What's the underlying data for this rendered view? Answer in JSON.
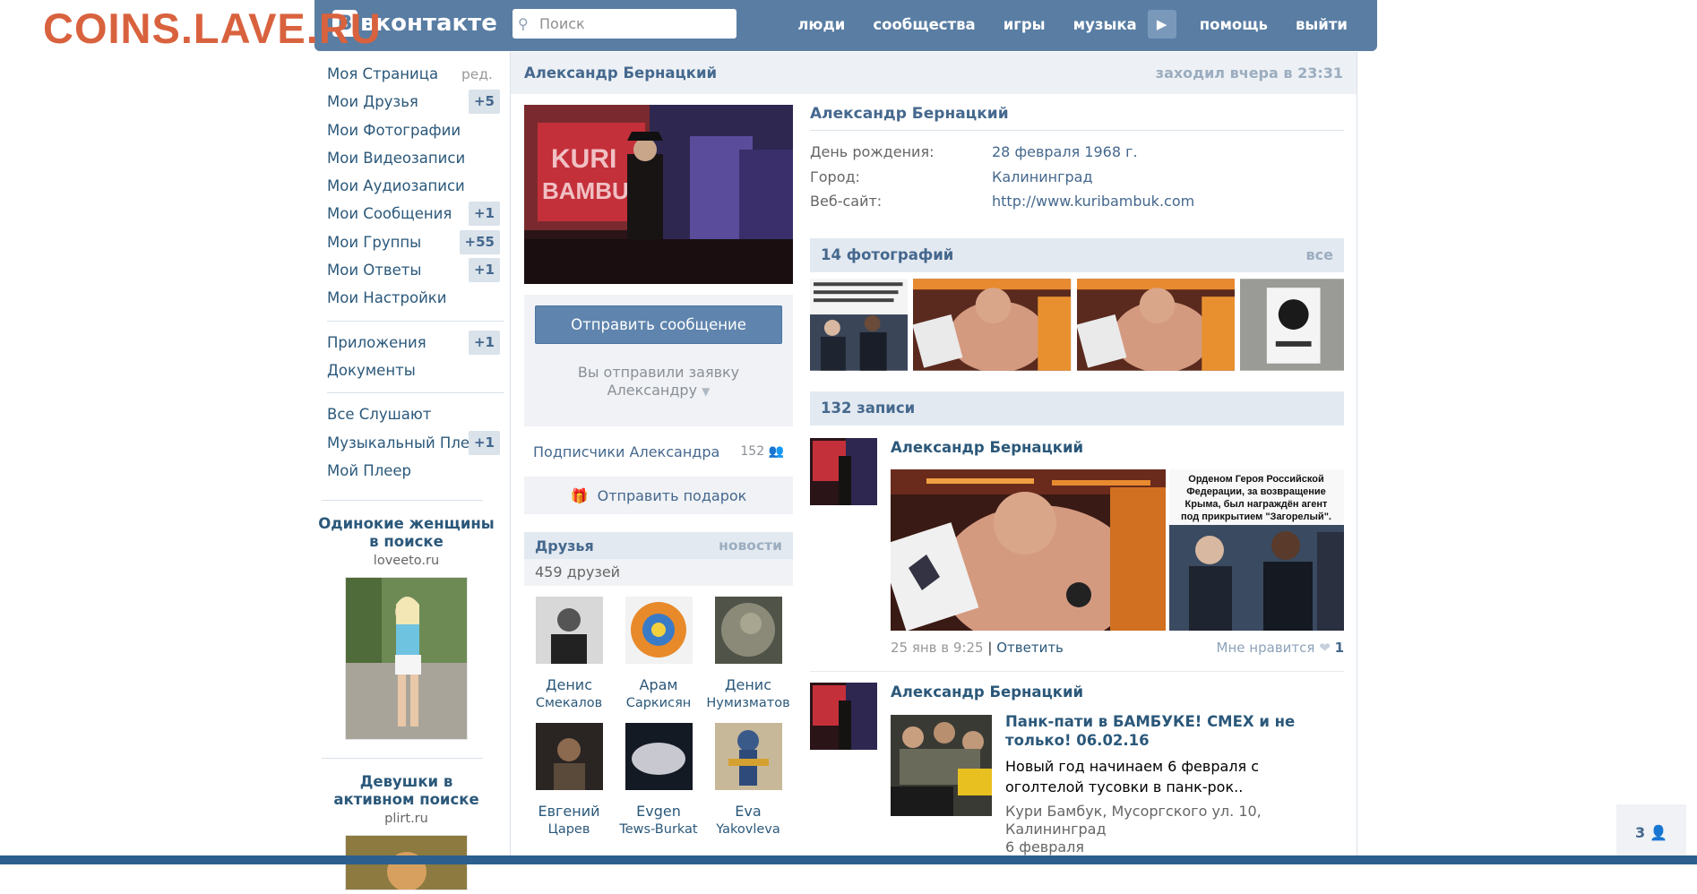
{
  "watermark": "COINS.LAVE.RU",
  "header": {
    "logo": "вконтакте",
    "search_placeholder": "Поиск",
    "nav": [
      "люди",
      "сообщества",
      "игры",
      "музыка",
      "помощь",
      "выйти"
    ]
  },
  "sidebar": {
    "edit": "ред.",
    "items": [
      {
        "label": "Моя Страница",
        "count": ""
      },
      {
        "label": "Мои Друзья",
        "count": "+5"
      },
      {
        "label": "Мои Фотографии",
        "count": ""
      },
      {
        "label": "Мои Видеозаписи",
        "count": ""
      },
      {
        "label": "Мои Аудиозаписи",
        "count": ""
      },
      {
        "label": "Мои Сообщения",
        "count": "+1"
      },
      {
        "label": "Мои Группы",
        "count": "+55"
      },
      {
        "label": "Мои Ответы",
        "count": "+1"
      },
      {
        "label": "Мои Настройки",
        "count": ""
      }
    ],
    "items2": [
      {
        "label": "Приложения",
        "count": "+1"
      },
      {
        "label": "Документы",
        "count": ""
      }
    ],
    "items3": [
      {
        "label": "Все Слушают",
        "count": ""
      },
      {
        "label": "Музыкальный Плеер",
        "count": "+1"
      },
      {
        "label": "Мой Плеер",
        "count": ""
      }
    ],
    "ads": [
      {
        "title": "Одинокие женщины в поиске",
        "url": "loveeto.ru"
      },
      {
        "title": "Девушки в активном поиске",
        "url": "plirt.ru"
      }
    ]
  },
  "profile": {
    "header_name": "Александр Бернацкий",
    "last_seen": "заходил вчера в 23:31",
    "name": "Александр Бернацкий",
    "info": [
      {
        "label": "День рождения:",
        "value": "28 февраля 1968 г."
      },
      {
        "label": "Город:",
        "value": "Калининград"
      },
      {
        "label": "Веб-сайт:",
        "value": "http://www.kuribambuk.com"
      }
    ],
    "send_message": "Отправить сообщение",
    "request_line1": "Вы отправили заявку",
    "request_line2": "Александру",
    "subscribers_label": "Подписчики Александра",
    "subscribers_count": "152",
    "gift": "Отправить подарок"
  },
  "friends": {
    "title": "Друзья",
    "news": "новости",
    "count": "459 друзей",
    "list": [
      {
        "first": "Денис",
        "last": "Смекалов"
      },
      {
        "first": "Арам",
        "last": "Саркисян"
      },
      {
        "first": "Денис",
        "last": "Нумизматов"
      },
      {
        "first": "Евгений",
        "last": "Царев"
      },
      {
        "first": "Evgen",
        "last": "Tews-Burkat"
      },
      {
        "first": "Eva",
        "last": "Yakovleva"
      }
    ]
  },
  "photos": {
    "title": "14 фотографий",
    "all": "все"
  },
  "wall": {
    "title": "132 записи",
    "post1": {
      "author": "Александр Бернацкий",
      "caption": "Орденом Героя Российской Федерации, за возвращение Крыма, был награждён агент под прикрытием \"Загорелый\".",
      "date": "25 янв в 9:25",
      "sep": "|",
      "reply": "Ответить",
      "like_label": "Мне нравится",
      "like_count": "1"
    },
    "post2": {
      "author": "Александр Бернацкий",
      "title": "Панк-пати в БАМБУКЕ! СМЕХ и не только! 06.02.16",
      "desc": "Новый год начинаем 6 февраля с оголтелой тусовки в панк-рок..",
      "meta": "Кури Бамбук, Мусоргского ул. 10, Калининград",
      "date": "6 февраля"
    }
  },
  "corner": {
    "count": "3"
  },
  "icons": {
    "search": "search-icon",
    "play": "play-icon",
    "people": "people-icon",
    "gift": "gift-icon",
    "heart": "heart-icon",
    "dropdown": "chevron-down-icon",
    "user": "user-icon"
  },
  "colors": {
    "header_bg": "#597DA3",
    "link": "#2B587A",
    "watermark": "#D9623E",
    "counter_bg": "#DAE2EA",
    "button": "#5F84AD"
  }
}
